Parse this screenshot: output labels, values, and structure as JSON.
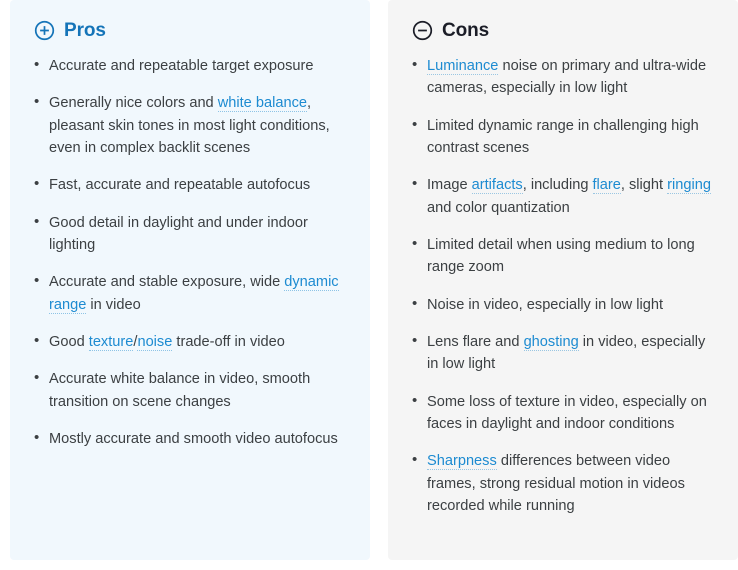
{
  "pros": {
    "icon": "circle-plus-icon",
    "title": "Pros",
    "accent_color": "#1574b8",
    "panel_bg": "#f1f8fd",
    "items": [
      [
        {
          "t": "text",
          "v": "Accurate and repeatable target exposure"
        }
      ],
      [
        {
          "t": "text",
          "v": "Generally nice colors and "
        },
        {
          "t": "link",
          "v": "white balance"
        },
        {
          "t": "text",
          "v": ", pleasant skin tones in most light conditions, even in complex backlit scenes"
        }
      ],
      [
        {
          "t": "text",
          "v": "Fast, accurate and repeatable autofocus"
        }
      ],
      [
        {
          "t": "text",
          "v": "Good detail in daylight and under indoor lighting"
        }
      ],
      [
        {
          "t": "text",
          "v": "Accurate and stable exposure, wide "
        },
        {
          "t": "link",
          "v": "dynamic range"
        },
        {
          "t": "text",
          "v": " in video"
        }
      ],
      [
        {
          "t": "text",
          "v": "Good "
        },
        {
          "t": "link",
          "v": "texture"
        },
        {
          "t": "text",
          "v": "/"
        },
        {
          "t": "link",
          "v": "noise"
        },
        {
          "t": "text",
          "v": " trade-off in video"
        }
      ],
      [
        {
          "t": "text",
          "v": "Accurate white balance in video, smooth transition on scene changes"
        }
      ],
      [
        {
          "t": "text",
          "v": "Mostly accurate and smooth video autofocus"
        }
      ]
    ]
  },
  "cons": {
    "icon": "circle-minus-icon",
    "title": "Cons",
    "accent_color": "#1b1d27",
    "panel_bg": "#f5f5f5",
    "items": [
      [
        {
          "t": "link",
          "v": "Luminance"
        },
        {
          "t": "text",
          "v": " noise on primary and ultra-wide cameras, especially in low light"
        }
      ],
      [
        {
          "t": "text",
          "v": "Limited dynamic range in challenging high contrast scenes"
        }
      ],
      [
        {
          "t": "text",
          "v": "Image "
        },
        {
          "t": "link",
          "v": "artifacts"
        },
        {
          "t": "text",
          "v": ", including "
        },
        {
          "t": "link",
          "v": "flare"
        },
        {
          "t": "text",
          "v": ", slight "
        },
        {
          "t": "link",
          "v": "ringing"
        },
        {
          "t": "text",
          "v": " and  color quantization"
        }
      ],
      [
        {
          "t": "text",
          "v": "Limited detail when using medium to long range zoom"
        }
      ],
      [
        {
          "t": "text",
          "v": "Noise in video, especially in low light"
        }
      ],
      [
        {
          "t": "text",
          "v": "Lens flare and "
        },
        {
          "t": "link",
          "v": "ghosting"
        },
        {
          "t": "text",
          "v": " in video, especially in low light"
        }
      ],
      [
        {
          "t": "text",
          "v": "Some loss of texture in video, especially on faces in daylight and indoor conditions"
        }
      ],
      [
        {
          "t": "link",
          "v": "Sharpness"
        },
        {
          "t": "text",
          "v": " differences between video frames, strong residual motion in videos recorded while running"
        }
      ]
    ]
  }
}
